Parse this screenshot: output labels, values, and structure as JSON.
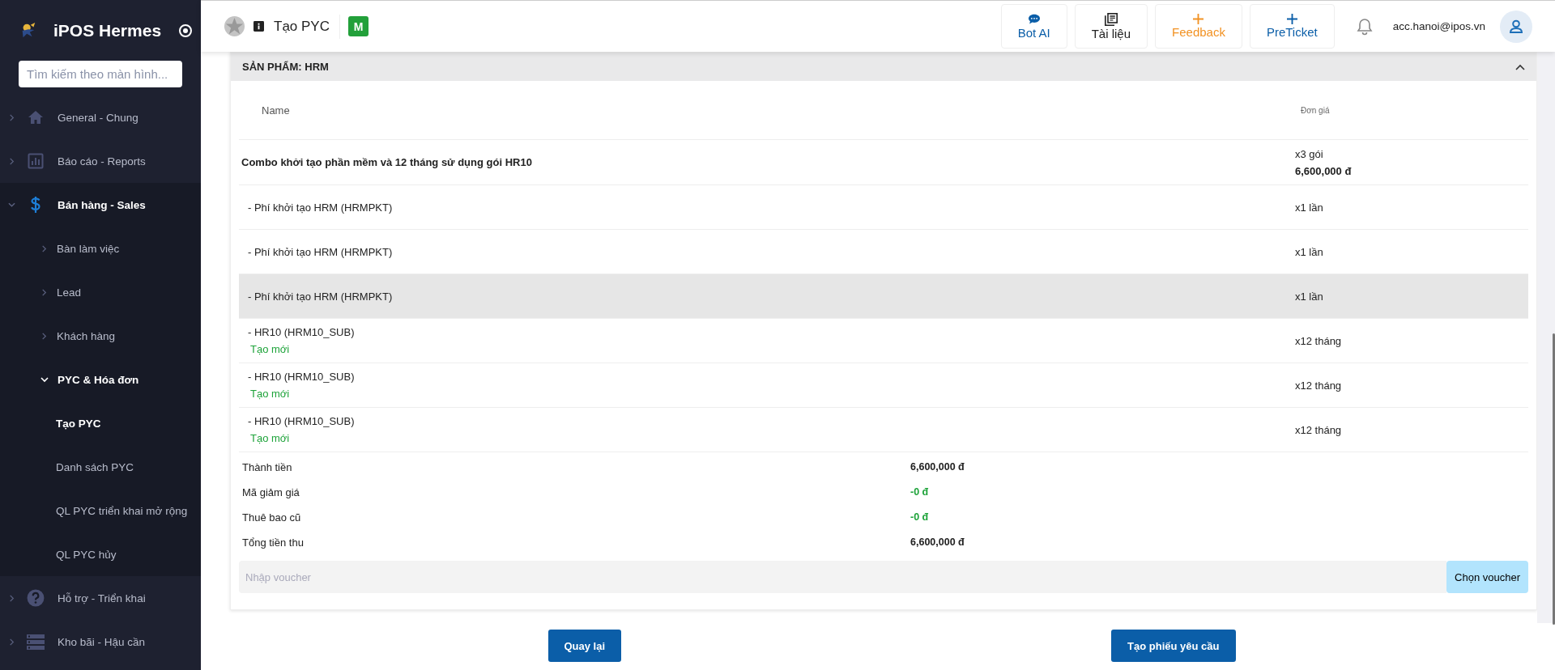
{
  "sidebar": {
    "brand": "iPOS Hermes",
    "search": {
      "placeholder": "Tìm kiếm theo màn hình..."
    },
    "items": [
      {
        "label": "General - Chung",
        "expanded": false
      },
      {
        "label": "Báo cáo - Reports",
        "expanded": false
      },
      {
        "label": "Bán hàng - Sales",
        "expanded": true,
        "children": [
          {
            "label": "Bàn làm việc",
            "expanded": false
          },
          {
            "label": "Lead",
            "expanded": false
          },
          {
            "label": "Khách hàng",
            "expanded": false
          },
          {
            "label": "PYC & Hóa đơn",
            "expanded": true,
            "children": [
              {
                "label": "Tạo PYC",
                "selected": true
              },
              {
                "label": "Danh sách PYC",
                "selected": false
              },
              {
                "label": "QL PYC triển khai mở rộng",
                "selected": false
              },
              {
                "label": "QL PYC hủy",
                "selected": false
              }
            ]
          }
        ]
      },
      {
        "label": "Hỗ trợ - Triển khai",
        "expanded": false
      },
      {
        "label": "Kho bãi - Hậu cần",
        "expanded": false
      }
    ]
  },
  "header": {
    "title": "Tạo PYC",
    "badge": "M",
    "actions": [
      {
        "label": "Bot AI",
        "kind": "chat"
      },
      {
        "label": "Tài liệu",
        "kind": "docs"
      },
      {
        "label": "Feedback",
        "kind": "feedback"
      },
      {
        "label": "PreTicket",
        "kind": "ticket"
      }
    ],
    "user": "acc.hanoi@ipos.vn"
  },
  "card": {
    "title": "SẢN PHẨM: HRM",
    "columns": [
      "Name",
      "Đơn giá"
    ],
    "rows": [
      {
        "name": "Combo khởi tạo phần mềm và 12 tháng sử dụng gói HR10",
        "kind": "combo",
        "qty": "x3 gói",
        "price": "6,600,000 đ",
        "highlighted": false
      },
      {
        "name": "- Phí khởi tạo HRM (HRMPKT)",
        "kind": "item",
        "qty": "x1 lần",
        "highlighted": false
      },
      {
        "name": "- Phí khởi tạo HRM (HRMPKT)",
        "kind": "item",
        "qty": "x1 lần",
        "highlighted": false
      },
      {
        "name": "- Phí khởi tạo HRM (HRMPKT)",
        "kind": "item",
        "qty": "x1 lần",
        "highlighted": true
      },
      {
        "name": "- HR10 (HRM10_SUB)",
        "kind": "item",
        "status": "Tạo mới",
        "qty": "x12 tháng",
        "highlighted": false
      },
      {
        "name": "- HR10 (HRM10_SUB)",
        "kind": "item",
        "status": "Tạo mới",
        "qty": "x12 tháng",
        "highlighted": false
      },
      {
        "name": "- HR10 (HRM10_SUB)",
        "kind": "item",
        "status": "Tạo mới",
        "qty": "x12 tháng",
        "highlighted": false
      }
    ],
    "totals": [
      {
        "label": "Thành tiền",
        "value": "6,600,000 đ",
        "kind": "amount"
      },
      {
        "label": "Mã giảm giá",
        "value": "-0 đ",
        "kind": "discount"
      },
      {
        "label": "Thuê bao cũ",
        "value": "-0 đ",
        "kind": "discount"
      },
      {
        "label": "Tổng tiền thu",
        "value": "6,600,000 đ",
        "kind": "amount"
      }
    ],
    "voucher": {
      "placeholder": "Nhập voucher",
      "button": "Chọn voucher"
    }
  },
  "footer": {
    "buttons": [
      "Quay lại",
      "Tạo phiếu yêu cầu"
    ]
  }
}
